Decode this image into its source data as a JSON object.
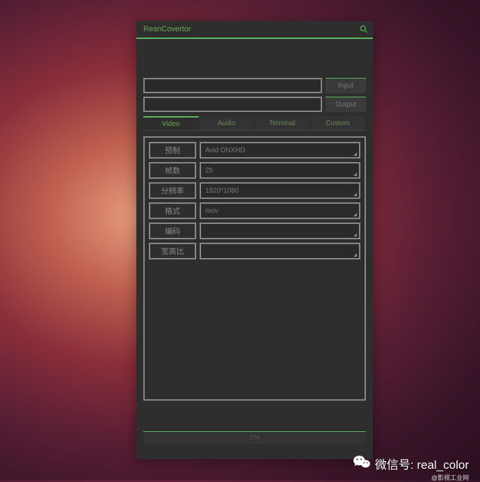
{
  "title": "ReanCovertor",
  "io": {
    "input_value": "",
    "output_value": "",
    "input_btn": "Input",
    "output_btn": "Output"
  },
  "tabs": [
    "Video",
    "Audio",
    "Terminal",
    "Custom"
  ],
  "active_tab": 0,
  "fields": [
    {
      "label": "预制",
      "value": "Avid DNXHD"
    },
    {
      "label": "帧数",
      "value": "25"
    },
    {
      "label": "分辨率",
      "value": "1920*1080"
    },
    {
      "label": "格式",
      "value": "mov"
    },
    {
      "label": "编码",
      "value": ""
    },
    {
      "label": "宽高比",
      "value": ""
    }
  ],
  "progress": "0%",
  "watermark": {
    "line1": "微信号: real_color",
    "line2": "@影视工业网"
  }
}
